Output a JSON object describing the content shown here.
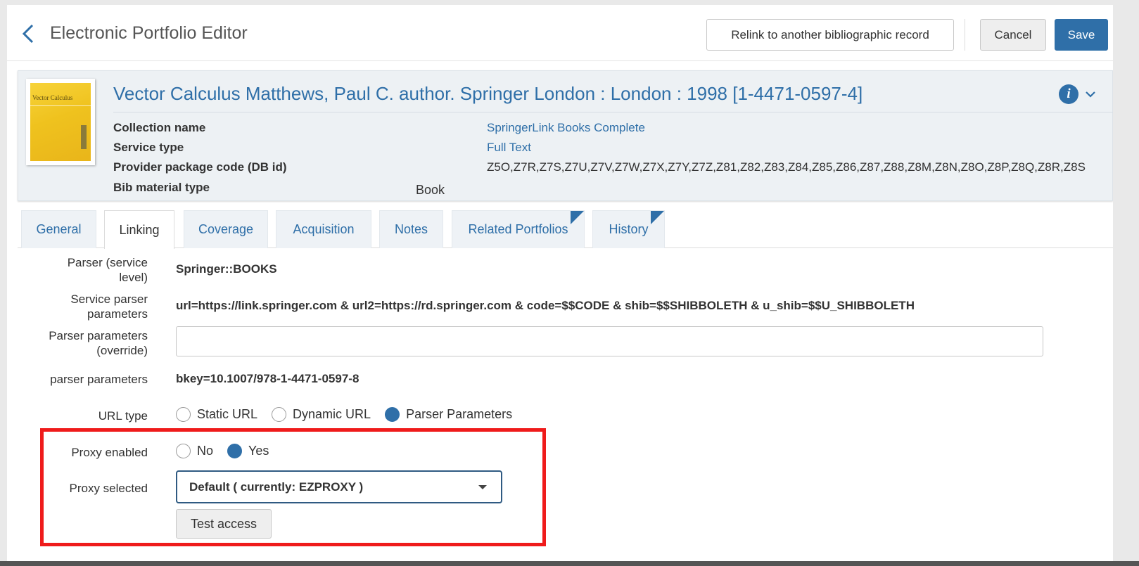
{
  "header": {
    "title": "Electronic Portfolio Editor",
    "relink_label": "Relink to another bibliographic record",
    "cancel_label": "Cancel",
    "save_label": "Save"
  },
  "record": {
    "title": "Vector Calculus Matthews, Paul C. author. Springer London : London : 1998 [1-4471-0597-4]",
    "cover_text": "Vector Calculus",
    "fields": [
      {
        "label": "Collection name",
        "value": "SpringerLink Books Complete"
      },
      {
        "label": "Service type",
        "value": "Full Text"
      },
      {
        "label": "Provider package code (DB id)",
        "value": "Z5O,Z7R,Z7S,Z7U,Z7V,Z7W,Z7X,Z7Y,Z7Z,Z81,Z82,Z83,Z84,Z85,Z86,Z87,Z88,Z8M,Z8N,Z8O,Z8P,Z8Q,Z8R,Z8S"
      },
      {
        "label": "Bib material type",
        "value": "Book"
      }
    ]
  },
  "tabs": [
    {
      "label": "General"
    },
    {
      "label": "Linking"
    },
    {
      "label": "Coverage"
    },
    {
      "label": "Acquisition"
    },
    {
      "label": "Notes"
    },
    {
      "label": "Related Portfolios"
    },
    {
      "label": "History"
    }
  ],
  "linking": {
    "parser_label_1": "Parser (service",
    "parser_label_2": "level)",
    "parser_value": "Springer::BOOKS",
    "service_params_label_1": "Service parser",
    "service_params_label_2": "parameters",
    "service_params_value": "url=https://link.springer.com & url2=https://rd.springer.com & code=$$CODE & shib=$$SHIBBOLETH & u_shib=$$U_SHIBBOLETH",
    "override_label_1": "Parser parameters",
    "override_label_2": "(override)",
    "override_value": "",
    "params_label": "parser parameters",
    "params_value": "bkey=10.1007/978-1-4471-0597-8",
    "url_type_label": "URL type",
    "url_type_options": [
      "Static URL",
      "Dynamic URL",
      "Parser Parameters"
    ],
    "url_type_selected": "Parser Parameters",
    "proxy_enabled_label": "Proxy enabled",
    "proxy_enabled_options": [
      "No",
      "Yes"
    ],
    "proxy_enabled_selected": "Yes",
    "proxy_selected_label": "Proxy selected",
    "proxy_selected_value": "Default ( currently: EZPROXY )",
    "test_access_label": "Test access"
  },
  "colors": {
    "accent": "#2f6fa8",
    "highlight": "#ef1b1b"
  }
}
